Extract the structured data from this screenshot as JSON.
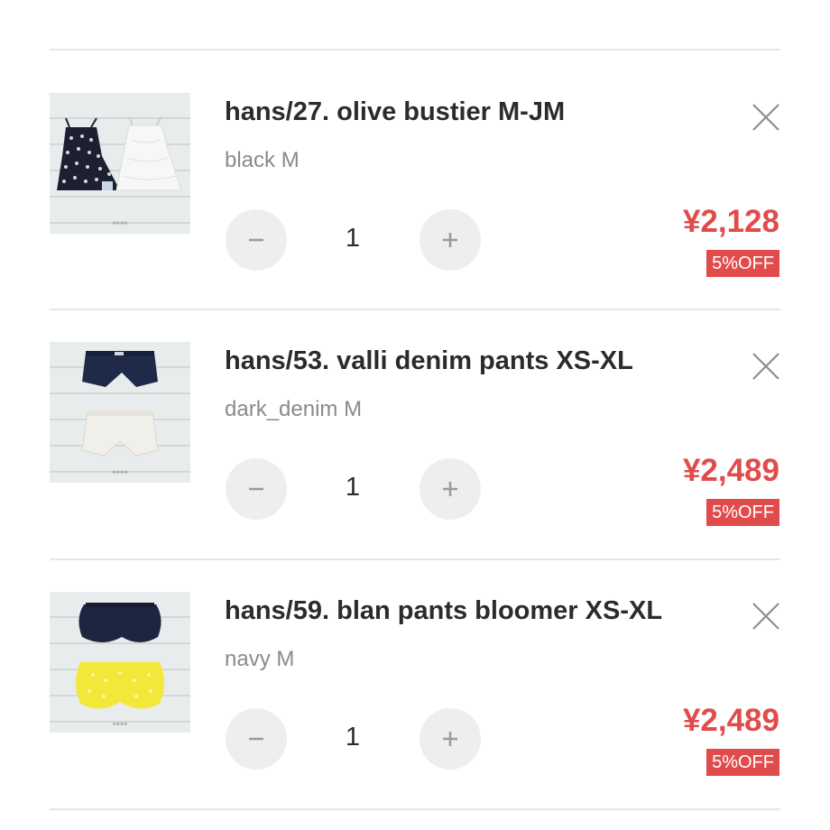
{
  "cart": {
    "items": [
      {
        "title": "hans/27. olive bustier M-JM",
        "variant": "black M",
        "quantity": "1",
        "price": "¥2,128",
        "discount_badge": "5%OFF",
        "image": "black polka-dot and white lace bustier tops"
      },
      {
        "title": "hans/53. valli denim pants XS-XL",
        "variant": "dark_denim M",
        "quantity": "1",
        "price": "¥2,489",
        "discount_badge": "5%OFF",
        "image": "dark denim and white denim shorts"
      },
      {
        "title": "hans/59. blan pants bloomer XS-XL",
        "variant": "navy M",
        "quantity": "1",
        "price": "¥2,489",
        "discount_badge": "5%OFF",
        "image": "navy and yellow bloomer shorts"
      }
    ]
  },
  "icons": {
    "remove": "close-icon",
    "decrement": "minus-icon",
    "increment": "plus-icon"
  },
  "colors": {
    "price": "#e24b4b",
    "badge_bg": "#e24b4b",
    "title": "#2b2b2b",
    "variant": "#8a8a8a",
    "qty_button_bg": "#eeeeee",
    "divider": "#e6e6e6"
  }
}
